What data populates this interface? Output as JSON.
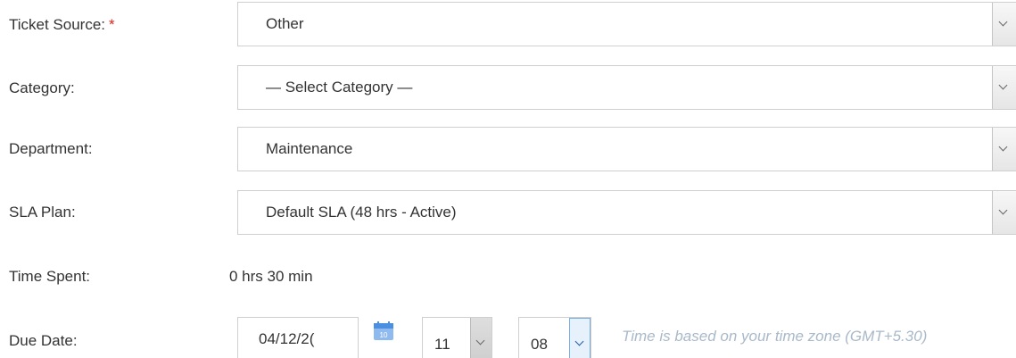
{
  "fields": {
    "ticket_source": {
      "label": "Ticket Source:",
      "required_mark": "*",
      "value": "Other"
    },
    "category": {
      "label": "Category:",
      "value": "— Select Category —"
    },
    "department": {
      "label": "Department:",
      "value": "Maintenance"
    },
    "sla_plan": {
      "label": "SLA Plan:",
      "value": "Default SLA (48 hrs - Active)"
    },
    "time_spent": {
      "label": "Time Spent:",
      "value": "0 hrs 30 min"
    },
    "due_date": {
      "label": "Due Date:",
      "date_value": "04/12/2(",
      "hour": "11",
      "minute": "08",
      "calendar_day": "10",
      "timezone_note": "Time is based on your time zone (GMT+5.30)"
    }
  },
  "icons": {
    "calendar": "calendar-icon",
    "dropdown": "chevron-down-icon"
  },
  "colors": {
    "required": "#d9241c",
    "calendar_icon": "#4a8fe0",
    "note_text": "#a9b9c9",
    "focus_arrow": "#e6f1fb"
  }
}
